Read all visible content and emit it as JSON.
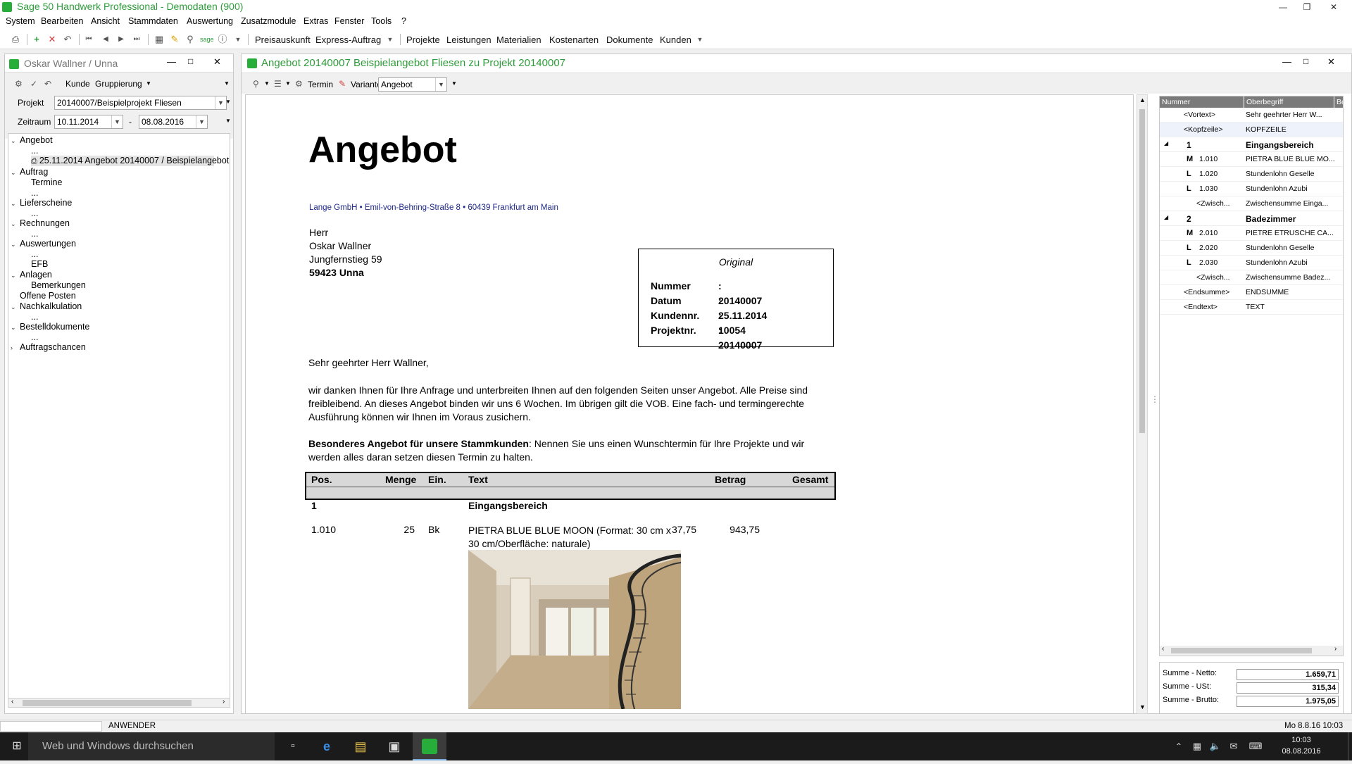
{
  "app": {
    "title": "Sage 50 Handwerk Professional - Demodaten (900)",
    "accent": "#27ae3a"
  },
  "menu": [
    "System",
    "Bearbeiten",
    "Ansicht",
    "Stammdaten",
    "Auswertung",
    "Zusatzmodule",
    "Extras",
    "Fenster",
    "Tools",
    "?"
  ],
  "toolbar": {
    "links": [
      "Preisauskunft",
      "Express-Auftrag",
      "Projekte",
      "Leistungen",
      "Materialien",
      "Kostenarten",
      "Dokumente",
      "Kunden"
    ]
  },
  "left": {
    "title": "Oskar Wallner / Unna",
    "kunde_label": "Kunde",
    "gruppierung_label": "Gruppierung",
    "projekt_label": "Projekt",
    "projekt_value": "20140007/Beispielprojekt Fliesen",
    "zeitraum_label": "Zeitraum",
    "date_from": "10.11.2014",
    "date_sep": "-",
    "date_to": "08.08.2016",
    "tree": [
      {
        "label": "Angebot",
        "level": 0,
        "exp": "v"
      },
      {
        "label": "...",
        "level": 2
      },
      {
        "label": "25.11.2014 Angebot 20140007 / Beispielangebot",
        "level": 2,
        "selected": true
      },
      {
        "label": "Auftrag",
        "level": 0,
        "exp": "v"
      },
      {
        "label": "Termine",
        "level": 1
      },
      {
        "label": "...",
        "level": 2
      },
      {
        "label": "Lieferscheine",
        "level": 0,
        "exp": "v"
      },
      {
        "label": "...",
        "level": 2
      },
      {
        "label": "Rechnungen",
        "level": 0,
        "exp": "v"
      },
      {
        "label": "...",
        "level": 2
      },
      {
        "label": "Auswertungen",
        "level": 0,
        "exp": "v"
      },
      {
        "label": "...",
        "level": 2
      },
      {
        "label": "EFB",
        "level": 1
      },
      {
        "label": "Anlagen",
        "level": 0,
        "exp": "v"
      },
      {
        "label": "Bemerkungen",
        "level": 1
      },
      {
        "label": "Offene Posten",
        "level": 0
      },
      {
        "label": "Nachkalkulation",
        "level": 0,
        "exp": "v"
      },
      {
        "label": "...",
        "level": 2
      },
      {
        "label": "Bestelldokumente",
        "level": 0,
        "exp": "v"
      },
      {
        "label": "...",
        "level": 2
      },
      {
        "label": "Auftragschancen",
        "level": 0,
        "exp": ">"
      }
    ]
  },
  "main": {
    "title": "Angebot 20140007 Beispielangebot Fliesen zu Projekt 20140007",
    "termin_label": "Termin",
    "variante_label": "Variante",
    "variante_value": "Angebot"
  },
  "doc": {
    "heading": "Angebot",
    "sender": "Lange GmbH • Emil-von-Behring-Straße 8 • 60439 Frankfurt am Main",
    "addr": [
      "Herr",
      "Oskar Wallner",
      "Jungfernstieg 59",
      "59423 Unna"
    ],
    "box_title": "Original",
    "box_rows": [
      [
        "Nummer",
        ": 20140007"
      ],
      [
        "Datum",
        ": 25.11.2014"
      ],
      [
        "Kundennr.",
        ": 10054"
      ],
      [
        "Projektnr.",
        ": 20140007"
      ]
    ],
    "greeting": "Sehr geehrter Herr Wallner,",
    "para1": "wir danken Ihnen für Ihre Anfrage und unterbreiten Ihnen auf den folgenden Seiten unser Angebot. Alle Preise sind freibleibend. An dieses Angebot binden wir uns 6 Wochen. Im übrigen gilt die VOB. Eine fach- und termingerechte Ausführung können wir Ihnen im Voraus zusichern.",
    "para2_bold": "Besonderes Angebot für unsere Stammkunden",
    "para2_rest": ": Nennen Sie uns einen Wunschtermin für Ihre Projekte und wir werden alles daran setzen diesen Termin zu halten.",
    "cols": [
      "Pos.",
      "Menge",
      "Ein.",
      "Text",
      "Betrag",
      "Gesamt"
    ],
    "sec1_pos": "1",
    "sec1_title": "Eingangsbereich",
    "row1": {
      "pos": "1.010",
      "menge": "25",
      "ein": "Bk",
      "text": "PIETRA BLUE BLUE MOON (Format: 30 cm x 30 cm/Oberfläche: naturale)",
      "betrag": "37,75",
      "gesamt": "943,75"
    }
  },
  "grid": {
    "headers": [
      "Nummer",
      "Oberbegriff",
      "Be"
    ],
    "rows": [
      {
        "a": "<Vortext>",
        "b": "Sehr geehrter Herr W...",
        "type": "",
        "bold": false
      },
      {
        "a": "<Kopfzeile>",
        "b": "KOPFZEILE",
        "type": "",
        "bold": false
      },
      {
        "a": "1",
        "b": "Eingangsbereich",
        "type": "",
        "bold": true,
        "exp": true
      },
      {
        "a": "1.010",
        "b": "PIETRA BLUE BLUE MO...",
        "type": "M",
        "bold": false
      },
      {
        "a": "1.020",
        "b": "Stundenlohn Geselle",
        "type": "L",
        "bold": false
      },
      {
        "a": "1.030",
        "b": "Stundenlohn Azubi",
        "type": "L",
        "bold": false
      },
      {
        "a": "<Zwisch...",
        "b": "Zwischensumme Einga...",
        "type": "",
        "bold": false,
        "indent": true
      },
      {
        "a": "2",
        "b": "Badezimmer",
        "type": "",
        "bold": true,
        "exp": true
      },
      {
        "a": "2.010",
        "b": "PIETRE ETRUSCHE CA...",
        "type": "M",
        "bold": false
      },
      {
        "a": "2.020",
        "b": "Stundenlohn Geselle",
        "type": "L",
        "bold": false
      },
      {
        "a": "2.030",
        "b": "Stundenlohn Azubi",
        "type": "L",
        "bold": false
      },
      {
        "a": "<Zwisch...",
        "b": "Zwischensumme Badez...",
        "type": "",
        "bold": false,
        "indent": true
      },
      {
        "a": "<Endsumme>",
        "b": "ENDSUMME",
        "type": "",
        "bold": false
      },
      {
        "a": "<Endtext>",
        "b": "TEXT",
        "type": "",
        "bold": false
      }
    ]
  },
  "sums": [
    {
      "label": "Summe - Netto:",
      "value": "1.659,71"
    },
    {
      "label": "Summe - USt:",
      "value": "315,34"
    },
    {
      "label": "Summe - Brutto:",
      "value": "1.975,05"
    }
  ],
  "status": {
    "user": "ANWENDER",
    "datetime": "Mo 8.8.16 10:03"
  },
  "taskbar": {
    "search": "Web und Windows durchsuchen",
    "time": "10:03",
    "date": "08.08.2016"
  }
}
